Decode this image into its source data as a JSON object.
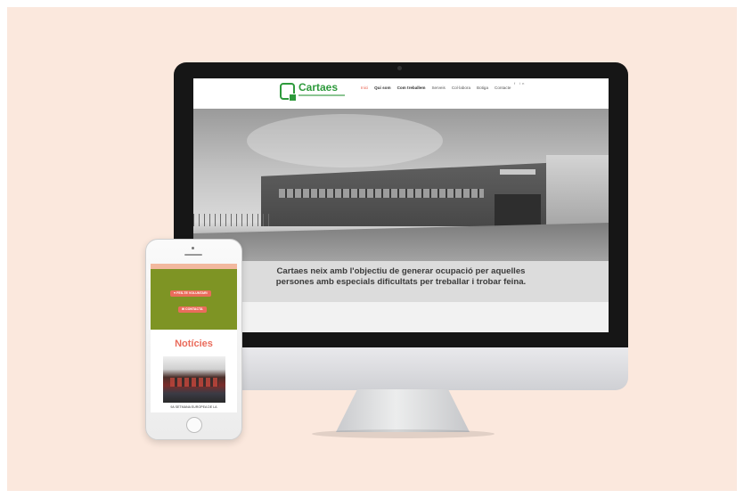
{
  "site": {
    "logo_name": "Cartaes",
    "nav": [
      "Inici",
      "Qui som",
      "Com treballem",
      "Serveis",
      "Col·labora",
      "Botiga",
      "Contacte"
    ],
    "social": "f in",
    "hero_caption_line1": "Cartaes neix amb l'objectiu de generar ocupació per aquelles",
    "hero_caption_line2": "persones amb especials dificultats per treballar i trobar feina."
  },
  "mobile": {
    "volunteer_button": "♥ FES-TE VOLUNTARI",
    "contact_button": "✉ CONTACTA",
    "news_title": "Notícies",
    "news_caption": "9A SETMANA EUROPEA DE LA"
  },
  "colors": {
    "brand_green": "#2e9a3c",
    "accent_coral": "#ea6c5c",
    "olive": "#7e9424",
    "background": "#fbe8dd"
  }
}
